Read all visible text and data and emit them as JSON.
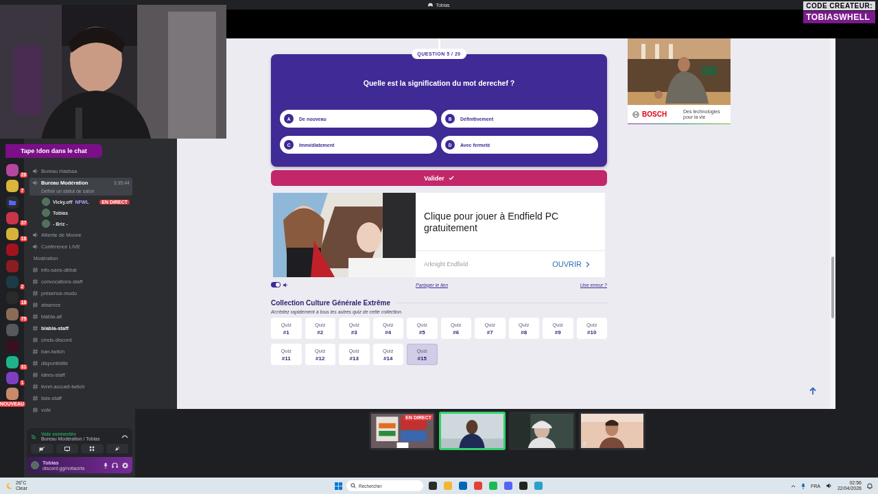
{
  "window": {
    "title": "Tobias"
  },
  "overlay": {
    "chat_prompt": "Tape !don dans le chat",
    "creator_label": "CODE CREATEUR:",
    "creator_code": "TOBIASWHELL"
  },
  "discord": {
    "servers": [
      {
        "kind": "server",
        "color": "#b4479e",
        "badge": "26"
      },
      {
        "kind": "server",
        "color": "#d9b53a",
        "badge": "7"
      },
      {
        "kind": "folder",
        "color": "#5865f2"
      },
      {
        "kind": "server",
        "color": "#c8354a",
        "badge": "37"
      },
      {
        "kind": "server",
        "color": "#d6b23c",
        "badge": "16"
      },
      {
        "kind": "server",
        "color": "#a3121f"
      },
      {
        "kind": "server",
        "color": "#8a1d22"
      },
      {
        "kind": "server",
        "color": "#1c3b45",
        "badge": "2"
      },
      {
        "kind": "server",
        "color": "#2a2a2a",
        "badge": "18"
      },
      {
        "kind": "server",
        "color": "#8c6b55",
        "badge": "75"
      },
      {
        "kind": "server",
        "color": "#55585c"
      },
      {
        "kind": "server",
        "color": "#3a1020"
      },
      {
        "kind": "server",
        "color": "#1fb38a",
        "badge": "31"
      },
      {
        "kind": "server",
        "color": "#7d3fc2",
        "badge": "1"
      },
      {
        "kind": "server",
        "color": "#c98a6a",
        "badge": "NOUVEAU"
      }
    ],
    "channels": [
      {
        "kind": "voice",
        "name": "Bureau Hasbaa",
        "selected": false
      },
      {
        "kind": "voice",
        "name": "Bureau Modération",
        "selected": true,
        "time": "3:35:44",
        "status": "Définir un statut de salon"
      },
      {
        "kind": "member",
        "name": "Vicky.off",
        "tag": "NFWL",
        "live": "EN DIRECT"
      },
      {
        "kind": "member",
        "name": "Tobias"
      },
      {
        "kind": "member",
        "name": "- Briz -"
      },
      {
        "kind": "voice",
        "name": "Attente de Moove",
        "selected": false
      },
      {
        "kind": "voice",
        "name": "Conférence LIVE",
        "selected": false
      },
      {
        "kind": "category",
        "name": "Modération"
      },
      {
        "kind": "text",
        "name": "info-sans-débat",
        "selected": false,
        "unread": false
      },
      {
        "kind": "text",
        "name": "convocations-staff",
        "selected": false,
        "unread": false
      },
      {
        "kind": "text",
        "name": "présence-modo",
        "selected": false,
        "unread": false
      },
      {
        "kind": "text",
        "name": "absence",
        "selected": false,
        "unread": false
      },
      {
        "kind": "text",
        "name": "blabla-all",
        "selected": false,
        "unread": false
      },
      {
        "kind": "text",
        "name": "blabla-staff",
        "selected": false,
        "unread": true
      },
      {
        "kind": "text",
        "name": "cmds-discord",
        "selected": false,
        "unread": false
      },
      {
        "kind": "text",
        "name": "ban-twitch",
        "selected": false,
        "unread": false
      },
      {
        "kind": "text",
        "name": "disponibilité",
        "selected": false,
        "unread": false
      },
      {
        "kind": "text",
        "name": "idées-staff",
        "selected": false,
        "unread": false
      },
      {
        "kind": "text",
        "name": "livret-accueil-twitch",
        "selected": false,
        "unread": false
      },
      {
        "kind": "text",
        "name": "liste-staff",
        "selected": false,
        "unread": false
      },
      {
        "kind": "text",
        "name": "vote",
        "selected": false,
        "unread": false
      }
    ],
    "voice_panel": {
      "status": "Voix connectée",
      "location": "Bureau Modération / Tobias"
    },
    "user_panel": {
      "name": "Tobias",
      "subtitle": "discord.gg/nofacefa"
    }
  },
  "quiz": {
    "progress": "QUESTION 5 / 20",
    "question": "Quelle est la signification du mot derechef ?",
    "answers": [
      {
        "letter": "A",
        "text": "De nouveau",
        "selected": false
      },
      {
        "letter": "B",
        "text": "Définitivement",
        "selected": false
      },
      {
        "letter": "C",
        "text": "Immédiatement",
        "selected": false
      },
      {
        "letter": "D",
        "text": "Avec fermeté",
        "selected": false
      }
    ],
    "submit": "Valider"
  },
  "ad": {
    "headline": "Clique pour jouer à Endfield PC gratuitement",
    "advertiser": "Arknight Endfield",
    "action": "OUVRIR"
  },
  "controls": {
    "sound_on": true,
    "share_link": "Partager le lien",
    "report_link": "Une erreur ?"
  },
  "collection": {
    "title": "Collection Culture Générale Extrême",
    "subtitle": "Accédez rapidement à tous les autres quiz de cette collection.",
    "quizzes": [
      {
        "label": "Quiz",
        "number": "#1",
        "selected": false
      },
      {
        "label": "Quiz",
        "number": "#2",
        "selected": false
      },
      {
        "label": "Quiz",
        "number": "#3",
        "selected": false
      },
      {
        "label": "Quiz",
        "number": "#4",
        "selected": false
      },
      {
        "label": "Quiz",
        "number": "#5",
        "selected": false
      },
      {
        "label": "Quiz",
        "number": "#6",
        "selected": false
      },
      {
        "label": "Quiz",
        "number": "#7",
        "selected": false
      },
      {
        "label": "Quiz",
        "number": "#8",
        "selected": false
      },
      {
        "label": "Quiz",
        "number": "#9",
        "selected": false
      },
      {
        "label": "Quiz",
        "number": "#10",
        "selected": false
      },
      {
        "label": "Quiz",
        "number": "#11",
        "selected": false
      },
      {
        "label": "Quiz",
        "number": "#12",
        "selected": false
      },
      {
        "label": "Quiz",
        "number": "#13",
        "selected": false
      },
      {
        "label": "Quiz",
        "number": "#14",
        "selected": false
      },
      {
        "label": "Quiz",
        "number": "#15",
        "selected": true
      }
    ]
  },
  "side_ad": {
    "brand": "BOSCH",
    "tagline": "Des technologies pour la vie"
  },
  "stream_tiles": [
    {
      "badge": "EN DIRECT",
      "selected": false,
      "muted": false
    },
    {
      "selected": true,
      "muted": false
    },
    {
      "selected": false,
      "muted": false
    },
    {
      "selected": false,
      "muted": true
    }
  ],
  "taskbar": {
    "temperature": "26°C",
    "weather": "Clear",
    "search": "Rechercher",
    "language": "FRA",
    "time": "02:56",
    "date": "22/04/2026"
  }
}
